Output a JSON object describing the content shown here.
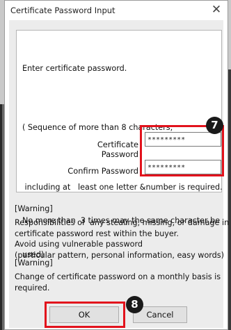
{
  "window": {
    "title": "Certificate Password Input",
    "close_glyph": "✕"
  },
  "instructions": {
    "line1": "Enter certificate password.",
    "line2": "( Sequence of more than 8 characters,",
    "line3": " including at   least one letter &number is required.",
    "line4": "No more than  3 times may the same character be",
    "line5": "used)"
  },
  "fields": {
    "certificate_password": {
      "label": "Certificate Password",
      "value": "*********"
    },
    "confirm_password": {
      "label": "Confirm Password",
      "value": "*********"
    }
  },
  "warning1": {
    "heading": "[Warning]",
    "line1": "Responsibilities of  any stealing, missing, or damage in",
    "line2": "certificate password rest within the buyer.",
    "line3": "Avoid using vulnerable password",
    "line4": "(particular pattern, personal information, easy words)"
  },
  "warning2": {
    "heading": "[Warning]",
    "line1": "Change of certificate password on a monthly basis is",
    "line2": "required."
  },
  "buttons": {
    "ok_label": "OK",
    "cancel_label": "Cancel"
  },
  "annotations": {
    "step7": "7",
    "step8": "8",
    "highlight_color": "#e2121c"
  }
}
